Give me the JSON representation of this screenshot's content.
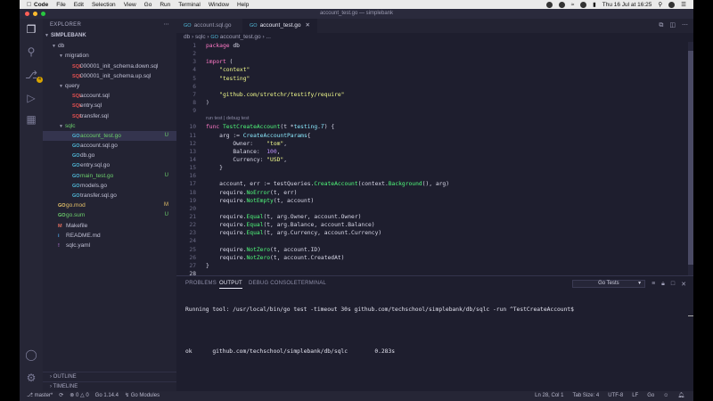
{
  "menubar": {
    "app": "Code",
    "items": [
      "File",
      "Edit",
      "Selection",
      "View",
      "Go",
      "Run",
      "Terminal",
      "Window",
      "Help"
    ],
    "datetime": "Thu 16 Jul at 16:25"
  },
  "window": {
    "title": "account_test.go — simplebank"
  },
  "sidebar": {
    "title": "EXPLORER",
    "project": "SIMPLEBANK",
    "items": [
      {
        "label": "db",
        "kind": "folder-open",
        "depth": 0,
        "badge": ""
      },
      {
        "label": "migration",
        "kind": "folder-open",
        "depth": 1,
        "badge": ""
      },
      {
        "label": "000001_init_schema.down.sql",
        "kind": "sql",
        "depth": 2,
        "badge": ""
      },
      {
        "label": "000001_init_schema.up.sql",
        "kind": "sql",
        "depth": 2,
        "badge": ""
      },
      {
        "label": "query",
        "kind": "folder-open",
        "depth": 1,
        "badge": ""
      },
      {
        "label": "account.sql",
        "kind": "sql",
        "depth": 2,
        "badge": ""
      },
      {
        "label": "entry.sql",
        "kind": "sql",
        "depth": 2,
        "badge": ""
      },
      {
        "label": "transfer.sql",
        "kind": "sql",
        "depth": 2,
        "badge": ""
      },
      {
        "label": "sqlc",
        "kind": "folder-open-green",
        "depth": 1,
        "badge": ""
      },
      {
        "label": "account_test.go",
        "kind": "go-green",
        "depth": 2,
        "badge": "U",
        "selected": true
      },
      {
        "label": "account.sql.go",
        "kind": "go",
        "depth": 2,
        "badge": ""
      },
      {
        "label": "db.go",
        "kind": "go",
        "depth": 2,
        "badge": ""
      },
      {
        "label": "entry.sql.go",
        "kind": "go",
        "depth": 2,
        "badge": ""
      },
      {
        "label": "main_test.go",
        "kind": "go-green",
        "depth": 2,
        "badge": "U"
      },
      {
        "label": "models.go",
        "kind": "go",
        "depth": 2,
        "badge": ""
      },
      {
        "label": "transfer.sql.go",
        "kind": "go",
        "depth": 2,
        "badge": ""
      },
      {
        "label": "go.mod",
        "kind": "mod",
        "depth": 0,
        "badge": "M"
      },
      {
        "label": "go.sum",
        "kind": "sum",
        "depth": 0,
        "badge": "U"
      },
      {
        "label": "Makefile",
        "kind": "make",
        "depth": 0,
        "badge": ""
      },
      {
        "label": "README.md",
        "kind": "md",
        "depth": 0,
        "badge": ""
      },
      {
        "label": "sqlc.yaml",
        "kind": "yaml",
        "depth": 0,
        "badge": ""
      }
    ],
    "outline": "OUTLINE",
    "timeline": "TIMELINE"
  },
  "tabs": [
    {
      "label": "account.sql.go",
      "active": false
    },
    {
      "label": "account_test.go",
      "active": true
    }
  ],
  "breadcrumb": [
    "db",
    "sqlc",
    "account_test.go",
    "..."
  ],
  "editor": {
    "codelens": "run test | debug test",
    "current_line": 28,
    "lines": [
      {
        "n": 1,
        "tokens": [
          [
            "k",
            "package "
          ],
          [
            "p",
            "db"
          ]
        ]
      },
      {
        "n": 2,
        "tokens": []
      },
      {
        "n": 3,
        "tokens": [
          [
            "k",
            "import"
          ],
          [
            "p",
            " ("
          ]
        ]
      },
      {
        "n": 4,
        "tokens": [
          [
            "p",
            "    "
          ],
          [
            "s",
            "\"context\""
          ]
        ]
      },
      {
        "n": 5,
        "tokens": [
          [
            "p",
            "    "
          ],
          [
            "s",
            "\"testing\""
          ]
        ]
      },
      {
        "n": 6,
        "tokens": []
      },
      {
        "n": 7,
        "tokens": [
          [
            "p",
            "    "
          ],
          [
            "s",
            "\"github.com/stretchr/testify/require\""
          ]
        ]
      },
      {
        "n": 8,
        "tokens": [
          [
            "p",
            ")"
          ]
        ]
      },
      {
        "n": 9,
        "tokens": []
      },
      {
        "n": 10,
        "tokens": [
          [
            "k",
            "func "
          ],
          [
            "f",
            "TestCreateAccount"
          ],
          [
            "p",
            "(t *"
          ],
          [
            "v",
            "testing"
          ],
          [
            "p",
            "."
          ],
          [
            "t",
            "T"
          ],
          [
            "p",
            ") {"
          ]
        ]
      },
      {
        "n": 11,
        "tokens": [
          [
            "p",
            "    arg := "
          ],
          [
            "v",
            "CreateAccountParams"
          ],
          [
            "p",
            "{"
          ]
        ]
      },
      {
        "n": 12,
        "tokens": [
          [
            "p",
            "        Owner:    "
          ],
          [
            "s",
            "\"tom\""
          ],
          [
            "p",
            ","
          ]
        ]
      },
      {
        "n": 13,
        "tokens": [
          [
            "p",
            "        Balance:  "
          ],
          [
            "n",
            "100"
          ],
          [
            "p",
            ","
          ]
        ]
      },
      {
        "n": 14,
        "tokens": [
          [
            "p",
            "        Currency: "
          ],
          [
            "s",
            "\"USD\""
          ],
          [
            "p",
            ","
          ]
        ]
      },
      {
        "n": 15,
        "tokens": [
          [
            "p",
            "    }"
          ]
        ]
      },
      {
        "n": 16,
        "tokens": []
      },
      {
        "n": 17,
        "tokens": [
          [
            "p",
            "    account, err := testQueries."
          ],
          [
            "f",
            "CreateAccount"
          ],
          [
            "p",
            "(context."
          ],
          [
            "f",
            "Background"
          ],
          [
            "p",
            "(), arg)"
          ]
        ]
      },
      {
        "n": 18,
        "tokens": [
          [
            "p",
            "    require."
          ],
          [
            "f",
            "NoError"
          ],
          [
            "p",
            "(t, err)"
          ]
        ]
      },
      {
        "n": 19,
        "tokens": [
          [
            "p",
            "    require."
          ],
          [
            "f",
            "NotEmpty"
          ],
          [
            "p",
            "(t, account)"
          ]
        ]
      },
      {
        "n": 20,
        "tokens": []
      },
      {
        "n": 21,
        "tokens": [
          [
            "p",
            "    require."
          ],
          [
            "f",
            "Equal"
          ],
          [
            "p",
            "(t, arg.Owner, account.Owner)"
          ]
        ]
      },
      {
        "n": 22,
        "tokens": [
          [
            "p",
            "    require."
          ],
          [
            "f",
            "Equal"
          ],
          [
            "p",
            "(t, arg.Balance, account.Balance)"
          ]
        ]
      },
      {
        "n": 23,
        "tokens": [
          [
            "p",
            "    require."
          ],
          [
            "f",
            "Equal"
          ],
          [
            "p",
            "(t, arg.Currency, account.Currency)"
          ]
        ]
      },
      {
        "n": 24,
        "tokens": []
      },
      {
        "n": 25,
        "tokens": [
          [
            "p",
            "    require."
          ],
          [
            "f",
            "NotZero"
          ],
          [
            "p",
            "(t, account.ID)"
          ]
        ]
      },
      {
        "n": 26,
        "tokens": [
          [
            "p",
            "    require."
          ],
          [
            "f",
            "NotZero"
          ],
          [
            "p",
            "(t, account.CreatedAt)"
          ]
        ]
      },
      {
        "n": 27,
        "tokens": [
          [
            "p",
            "}"
          ]
        ]
      },
      {
        "n": 28,
        "tokens": []
      }
    ]
  },
  "panel": {
    "tabs": [
      "PROBLEMS",
      "OUTPUT",
      "DEBUG CONSOLE",
      "TERMINAL"
    ],
    "active_tab": "OUTPUT",
    "channel": "Go Tests",
    "output": [
      "Running tool: /usr/local/bin/go test -timeout 30s github.com/techschool/simplebank/db/sqlc -run ^TestCreateAccount$",
      "",
      "ok  \tgithub.com/techschool/simplebank/db/sqlc\t0.283s"
    ]
  },
  "status": {
    "branch": "master*",
    "errors": "0",
    "warnings": "0",
    "go_version": "Go 1.14.4",
    "go_modules": "Go Modules",
    "cursor": "Ln 28, Col 1",
    "tab_size": "Tab Size: 4",
    "encoding": "UTF-8",
    "eol": "LF",
    "language": "Go"
  },
  "colors": {
    "keyword": "#ff79c6",
    "string": "#f1fa8c",
    "function": "#50fa7b",
    "type": "#8be9fd",
    "number": "#bd93f9",
    "background": "#1e1e2e"
  }
}
